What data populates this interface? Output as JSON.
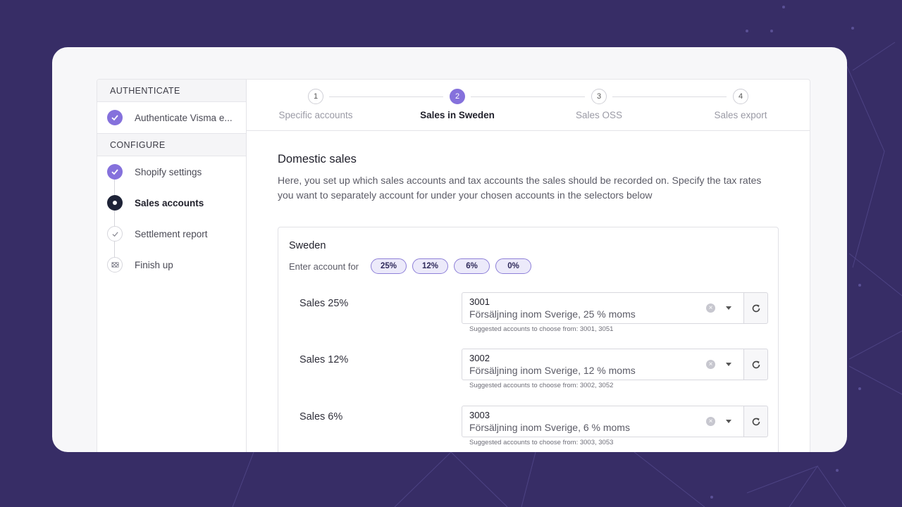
{
  "sidebar": {
    "sections": [
      {
        "header": "AUTHENTICATE",
        "items": [
          {
            "label": "Authenticate Visma e...",
            "status": "done"
          }
        ]
      },
      {
        "header": "CONFIGURE",
        "items": [
          {
            "label": "Shopify settings",
            "status": "done"
          },
          {
            "label": "Sales accounts",
            "status": "current"
          },
          {
            "label": "Settlement report",
            "status": "todo"
          },
          {
            "label": "Finish up",
            "status": "todo"
          }
        ]
      }
    ]
  },
  "stepper": {
    "steps": [
      {
        "num": "1",
        "label": "Specific accounts",
        "active": false
      },
      {
        "num": "2",
        "label": "Sales in Sweden",
        "active": true
      },
      {
        "num": "3",
        "label": "Sales OSS",
        "active": false
      },
      {
        "num": "4",
        "label": "Sales export",
        "active": false
      }
    ]
  },
  "main": {
    "title": "Domestic sales",
    "description": "Here, you set up which sales accounts and tax accounts the sales should be recorded on. Specify the tax rates you want to separately account for under your chosen accounts in the selectors below",
    "country_box": {
      "title": "Sweden",
      "enter_label": "Enter account for",
      "rates": [
        "25%",
        "12%",
        "6%",
        "0%"
      ],
      "accounts": [
        {
          "label": "Sales 25%",
          "code": "3001",
          "name": "Försäljning inom Sverige, 25 % moms",
          "hint": "Suggested accounts to choose from: 3001, 3051"
        },
        {
          "label": "Sales 12%",
          "code": "3002",
          "name": "Försäljning inom Sverige, 12 % moms",
          "hint": "Suggested accounts to choose from: 3002, 3052"
        },
        {
          "label": "Sales 6%",
          "code": "3003",
          "name": "Försäljning inom Sverige, 6 % moms",
          "hint": "Suggested accounts to choose from: 3003, 3053"
        }
      ]
    }
  },
  "colors": {
    "accent": "#8571dc",
    "background": "#372d66",
    "current_step": "#1e2337"
  }
}
